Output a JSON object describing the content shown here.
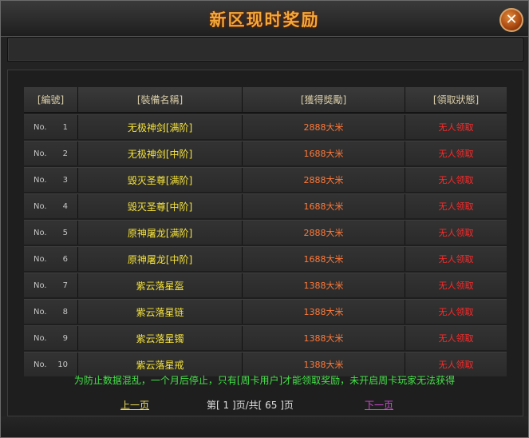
{
  "window": {
    "title": "新区现时奖励",
    "close_label": "✕"
  },
  "table": {
    "headers": [
      "[編號]",
      "[裝備名稱]",
      "[獲得獎勵]",
      "[領取狀態]"
    ],
    "rows": [
      {
        "no_label": "No.",
        "no": "1",
        "item": "无极神剑[满阶]",
        "reward": "2888大米",
        "status": "无人领取"
      },
      {
        "no_label": "No.",
        "no": "2",
        "item": "无极神剑[中阶]",
        "reward": "1688大米",
        "status": "无人领取"
      },
      {
        "no_label": "No.",
        "no": "3",
        "item": "毁灭圣尊[满阶]",
        "reward": "2888大米",
        "status": "无人领取"
      },
      {
        "no_label": "No.",
        "no": "4",
        "item": "毁灭圣尊[中阶]",
        "reward": "1688大米",
        "status": "无人领取"
      },
      {
        "no_label": "No.",
        "no": "5",
        "item": "原神屠龙[满阶]",
        "reward": "2888大米",
        "status": "无人领取"
      },
      {
        "no_label": "No.",
        "no": "6",
        "item": "原神屠龙[中阶]",
        "reward": "1688大米",
        "status": "无人领取"
      },
      {
        "no_label": "No.",
        "no": "7",
        "item": "紫云落星盔",
        "reward": "1388大米",
        "status": "无人领取"
      },
      {
        "no_label": "No.",
        "no": "8",
        "item": "紫云落星链",
        "reward": "1388大米",
        "status": "无人领取"
      },
      {
        "no_label": "No.",
        "no": "9",
        "item": "紫云落星镯",
        "reward": "1388大米",
        "status": "无人领取"
      },
      {
        "no_label": "No.",
        "no": "10",
        "item": "紫云落星戒",
        "reward": "1388大米",
        "status": "无人领取"
      }
    ]
  },
  "notice": "为防止数据混乱，一个月后停止，只有[周卡用户]才能领取奖励，未开启周卡玩家无法获得",
  "pager": {
    "prev_label": "上一页",
    "page_info": "第[ 1 ]页/共[ 65 ]页",
    "next_label": "下一页"
  },
  "colors": {
    "title": "#f2a93b",
    "item": "#f5e23a",
    "reward": "#ff7a3a",
    "status": "#ff2a2a",
    "notice": "#46e24a",
    "next_link": "#d04ad6"
  }
}
